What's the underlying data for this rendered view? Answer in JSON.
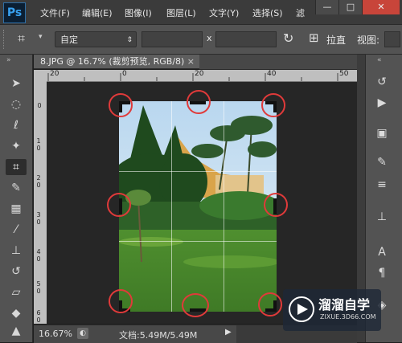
{
  "app": {
    "logo": "Ps"
  },
  "menu": {
    "items": [
      "文件(F)",
      "编辑(E)",
      "图像(I)",
      "图层(L)",
      "文字(Y)",
      "选择(S)",
      "滤"
    ]
  },
  "window_controls": {
    "minimize": "—",
    "maximize": "□",
    "close": "✕"
  },
  "options": {
    "preset": "自定",
    "ratio_separator": "x",
    "straighten_label": "拉直",
    "view_label": "视图:"
  },
  "document": {
    "tab_title": "8.JPG @ 16.7% (裁剪预览, RGB/8)",
    "close": "×",
    "zoom": "16.67%",
    "doc_size": "文档:5.49M/5.49M"
  },
  "ruler": {
    "h_labels": [
      "20",
      "0",
      "20",
      "40",
      "50"
    ],
    "v_labels": [
      "0",
      "1 0",
      "2 0",
      "3 0",
      "4 0",
      "5 0",
      "6 0"
    ]
  },
  "watermark": {
    "brand": "溜溜自学",
    "url": "ZIXUE.3D66.COM"
  },
  "colors": {
    "highlight_circle": "#e03a3a",
    "ps_blue": "#38a0ee"
  }
}
